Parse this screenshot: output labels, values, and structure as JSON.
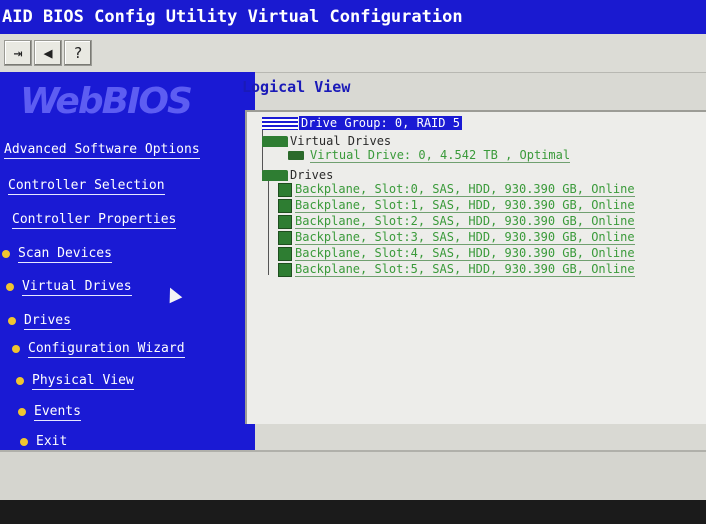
{
  "window": {
    "title": "AID BIOS Config Utility Virtual Configuration"
  },
  "toolbar": {
    "buttons": [
      {
        "icon": "exit-icon",
        "glyph": "⇥"
      },
      {
        "icon": "speaker-icon",
        "glyph": "◀"
      },
      {
        "icon": "help-icon",
        "glyph": "?"
      }
    ]
  },
  "sidebar": {
    "logo_text": "WebBIOS",
    "items": [
      {
        "label": "Advanced Software Options",
        "bullet": false
      },
      {
        "label": "Controller Selection",
        "bullet": false
      },
      {
        "label": "Controller Properties",
        "bullet": false
      },
      {
        "label": "Scan Devices",
        "bullet": true
      },
      {
        "label": "Virtual Drives",
        "bullet": true
      },
      {
        "label": "Drives",
        "bullet": true
      },
      {
        "label": "Configuration Wizard",
        "bullet": true
      },
      {
        "label": "Physical View",
        "bullet": true
      },
      {
        "label": "Events",
        "bullet": true
      },
      {
        "label": "Exit",
        "bullet": true
      }
    ]
  },
  "main": {
    "title": "Logical View",
    "tree": {
      "drive_group": "Drive Group: 0, RAID 5",
      "virtual_drives_label": "Virtual Drives",
      "virtual_drive": "Virtual Drive: 0, 4.542 TB , Optimal",
      "drives_label": "Drives",
      "drives": [
        "Backplane, Slot:0, SAS, HDD, 930.390 GB, Online",
        "Backplane, Slot:1, SAS, HDD, 930.390 GB, Online",
        "Backplane, Slot:2, SAS, HDD, 930.390 GB, Online",
        "Backplane, Slot:3, SAS, HDD, 930.390 GB, Online",
        "Backplane, Slot:4, SAS, HDD, 930.390 GB, Online",
        "Backplane, Slot:5, SAS, HDD, 930.390 GB, Online"
      ]
    }
  },
  "colors": {
    "bios_blue": "#1a1ad4",
    "tree_green": "#3a9a3a",
    "bullet_yellow": "#f0c430"
  }
}
